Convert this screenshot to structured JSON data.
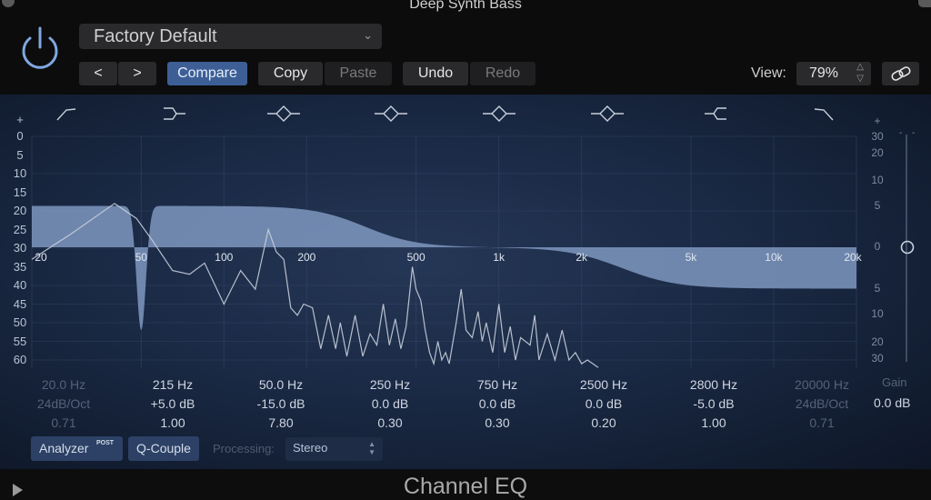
{
  "window": {
    "title": "Deep Synth Bass"
  },
  "header": {
    "preset": "Factory Default",
    "prev_label": "<",
    "next_label": ">",
    "compare_label": "Compare",
    "copy_label": "Copy",
    "paste_label": "Paste",
    "undo_label": "Undo",
    "redo_label": "Redo",
    "view_label": "View:",
    "view_value": "79%",
    "link_icon": "link-icon",
    "power_icon": "power-icon"
  },
  "graph": {
    "band_icons": [
      "low-cut-icon",
      "low-shelf-icon",
      "bell-icon",
      "bell-icon",
      "bell-icon",
      "bell-icon",
      "high-shelf-icon",
      "high-cut-icon"
    ],
    "left_plus": "+",
    "left_scale": [
      "0",
      "5",
      "10",
      "15",
      "20",
      "25",
      "30",
      "35",
      "40",
      "45",
      "50",
      "55",
      "60"
    ],
    "right_plus": "+",
    "right_scale": [
      {
        "label": "30",
        "db": 30
      },
      {
        "label": "20",
        "db": 20
      },
      {
        "label": "10",
        "db": 10
      },
      {
        "label": "5",
        "db": 5
      },
      {
        "label": "0",
        "db": 0
      },
      {
        "label": "5",
        "db": -5
      },
      {
        "label": "10",
        "db": -10
      },
      {
        "label": "20",
        "db": -20
      },
      {
        "label": "30",
        "db": -30
      }
    ],
    "freq_labels": [
      {
        "label": "20",
        "hz": 20
      },
      {
        "label": "50",
        "hz": 50
      },
      {
        "label": "100",
        "hz": 100
      },
      {
        "label": "200",
        "hz": 200
      },
      {
        "label": "500",
        "hz": 500
      },
      {
        "label": "1k",
        "hz": 1000
      },
      {
        "label": "2k",
        "hz": 2000
      },
      {
        "label": "5k",
        "hz": 5000
      },
      {
        "label": "10k",
        "hz": 10000
      },
      {
        "label": "20k",
        "hz": 20000
      }
    ]
  },
  "bands": [
    {
      "freq": "20.0 Hz",
      "gain": "24dB/Oct",
      "q": "0.71",
      "enabled": false
    },
    {
      "freq": "215 Hz",
      "gain": "+5.0 dB",
      "q": "1.00",
      "enabled": true
    },
    {
      "freq": "50.0 Hz",
      "gain": "-15.0 dB",
      "q": "7.80",
      "enabled": true
    },
    {
      "freq": "250 Hz",
      "gain": "0.0 dB",
      "q": "0.30",
      "enabled": true
    },
    {
      "freq": "750 Hz",
      "gain": "0.0 dB",
      "q": "0.30",
      "enabled": true
    },
    {
      "freq": "2500 Hz",
      "gain": "0.0 dB",
      "q": "0.20",
      "enabled": true
    },
    {
      "freq": "2800 Hz",
      "gain": "-5.0 dB",
      "q": "1.00",
      "enabled": true
    },
    {
      "freq": "20000 Hz",
      "gain": "24dB/Oct",
      "q": "0.71",
      "enabled": false
    }
  ],
  "gain": {
    "label": "Gain",
    "value": "0.0 dB",
    "db": 0
  },
  "bottom": {
    "analyzer_label": "Analyzer",
    "analyzer_badge": "POST",
    "qcouple_label": "Q-Couple",
    "processing_label": "Processing:",
    "processing_value": "Stereo"
  },
  "footer": {
    "plugin_name": "Channel EQ"
  }
}
